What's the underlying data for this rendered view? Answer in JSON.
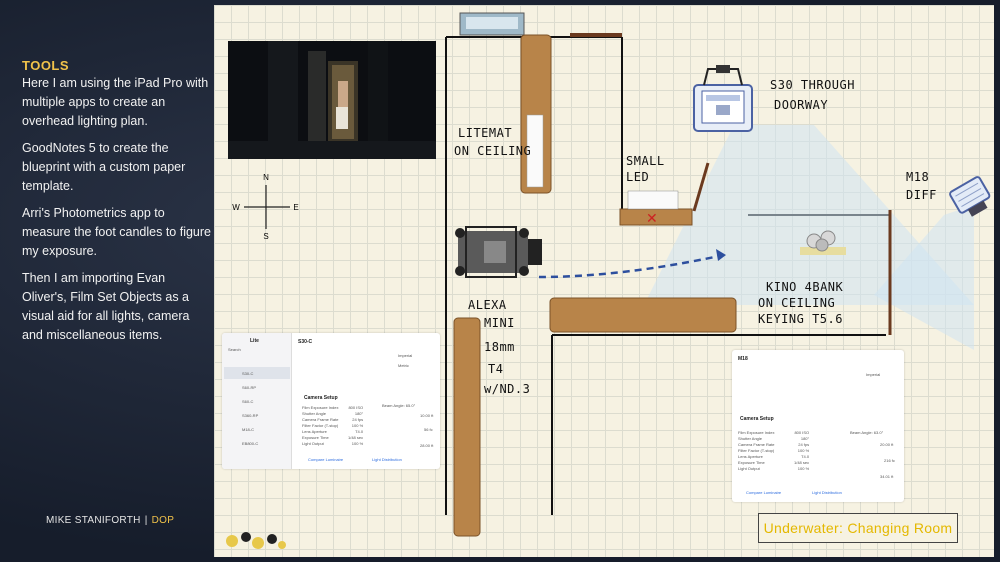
{
  "left_panel": {
    "title": "TOOLS",
    "paragraphs": [
      "Here I am using the iPad Pro with multiple apps to create an overhead lighting plan.",
      "GoodNotes 5 to create the blueprint with a custom paper template.",
      "Arri's Photometrics app to measure the foot candles to figure my exposure.",
      "Then I am importing Evan Oliver's, Film Set Objects as a visual aid for all lights, camera and miscellaneous items."
    ]
  },
  "footer": {
    "name": "MIKE STANIFORTH",
    "separator": "|",
    "role": "DOP"
  },
  "compass": {
    "n": "N",
    "s": "S",
    "e": "E",
    "w": "W"
  },
  "labels": {
    "litemat_1": "LITEMAT",
    "litemat_2": "ON CEILING",
    "s30_1": "S30 THROUGH",
    "s30_2": "DOORWAY",
    "small_led_1": "SMALL",
    "small_led_2": "LED",
    "m18_1": "M18",
    "m18_2": "DIFF",
    "kino_1": "KINO 4BANK",
    "kino_2": "ON CEILING",
    "kino_3": "KEYING T5.6",
    "alexa_1": "ALEXA",
    "alexa_2": "MINI",
    "alexa_3": "18mm",
    "alexa_4": "T4",
    "alexa_5": "w/ND.3"
  },
  "caption": "Underwater: Changing Room",
  "app_left": {
    "header": "Lite",
    "title": "S30-C",
    "search": "Search",
    "list": [
      "S30-C",
      "S60-RP",
      "S60-C",
      "S360-RP",
      "M18-C",
      "EB800-C"
    ],
    "toggle_1": "Imperial",
    "toggle_2": "Metric",
    "section": "Camera Setup",
    "beam": "Beam Angle: 65.0°",
    "rows": [
      "Film Exposure Index",
      "Shutter Angle",
      "Camera Frame Rate",
      "Filter Factor (T-stop)",
      "Lens Aperture",
      "Exposure Time",
      "Light Output"
    ],
    "vals": [
      "800 ISO",
      "180°",
      "24 fps",
      "100 %",
      "T4.0",
      "1/48 sec",
      "100 %"
    ],
    "dist": "10.00 ft",
    "lum": "56 fc",
    "spot": "28.00 ft",
    "bottom_left": "Compare Luminaire",
    "bottom_right": "Light Distribution"
  },
  "app_right": {
    "title": "M18",
    "toggle": "Imperial",
    "section": "Camera Setup",
    "beam": "Beam Angle: 63.0°",
    "rows": [
      "Film Exposure Index",
      "Shutter Angle",
      "Camera Frame Rate",
      "Filter Factor (T-stop)",
      "Lens Aperture",
      "Exposure Time",
      "Light Output"
    ],
    "vals": [
      "800 ISO",
      "180°",
      "24 fps",
      "100 %",
      "T4.0",
      "1/48 sec",
      "100 %"
    ],
    "dist": "20.00 ft",
    "lum": "216 fc",
    "spot": "34.01 ft",
    "bottom_left": "Compare Luminaire",
    "bottom_right": "Light Distribution"
  }
}
